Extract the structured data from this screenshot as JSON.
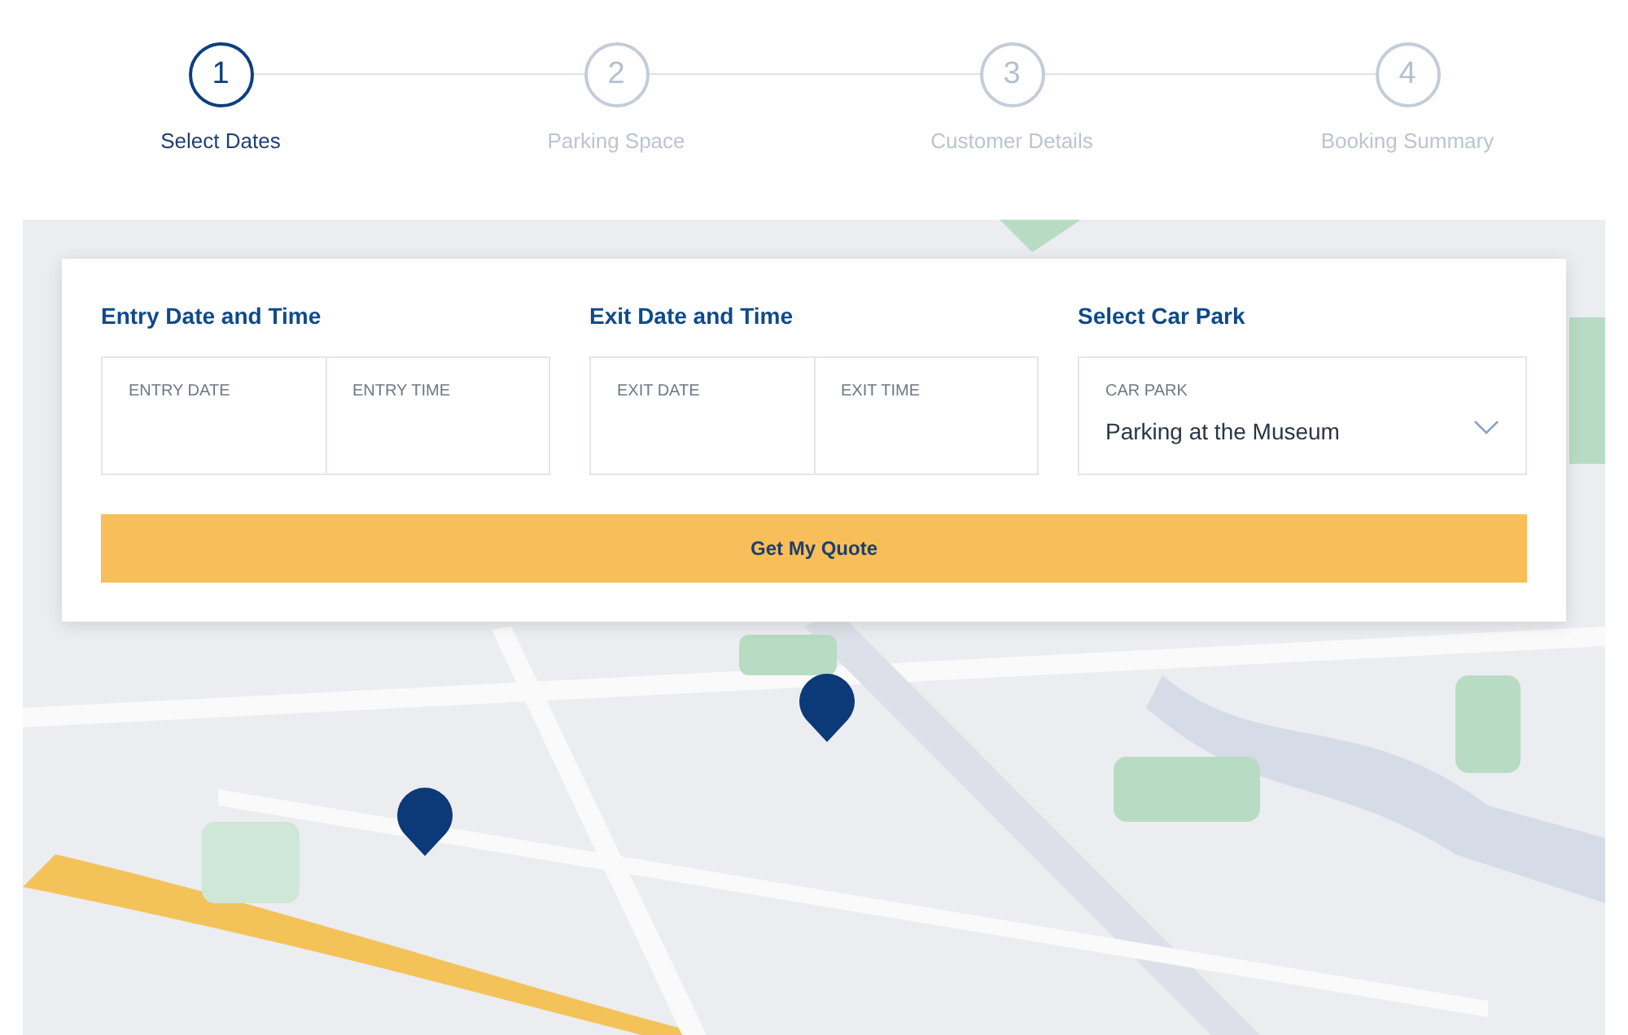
{
  "steps": [
    {
      "number": "1",
      "label": "Select Dates",
      "selected": true
    },
    {
      "number": "2",
      "label": "Parking Space",
      "selected": false
    },
    {
      "number": "3",
      "label": "Customer Details",
      "selected": false
    },
    {
      "number": "4",
      "label": "Booking Summary",
      "selected": false
    }
  ],
  "booking_form": {
    "sections": [
      {
        "kind": "pair",
        "title": "Entry Date and Time",
        "fields": [
          {
            "label": "ENTRY DATE"
          },
          {
            "label": "ENTRY TIME"
          }
        ]
      },
      {
        "kind": "pair",
        "title": "Exit Date and Time",
        "fields": [
          {
            "label": "EXIT DATE"
          },
          {
            "label": "EXIT TIME"
          }
        ]
      },
      {
        "kind": "select",
        "title": "Select Car Park",
        "fields": [
          {
            "label": "CAR PARK",
            "value": "Parking at the Museum"
          }
        ]
      }
    ],
    "submit": "Get My Quote"
  }
}
